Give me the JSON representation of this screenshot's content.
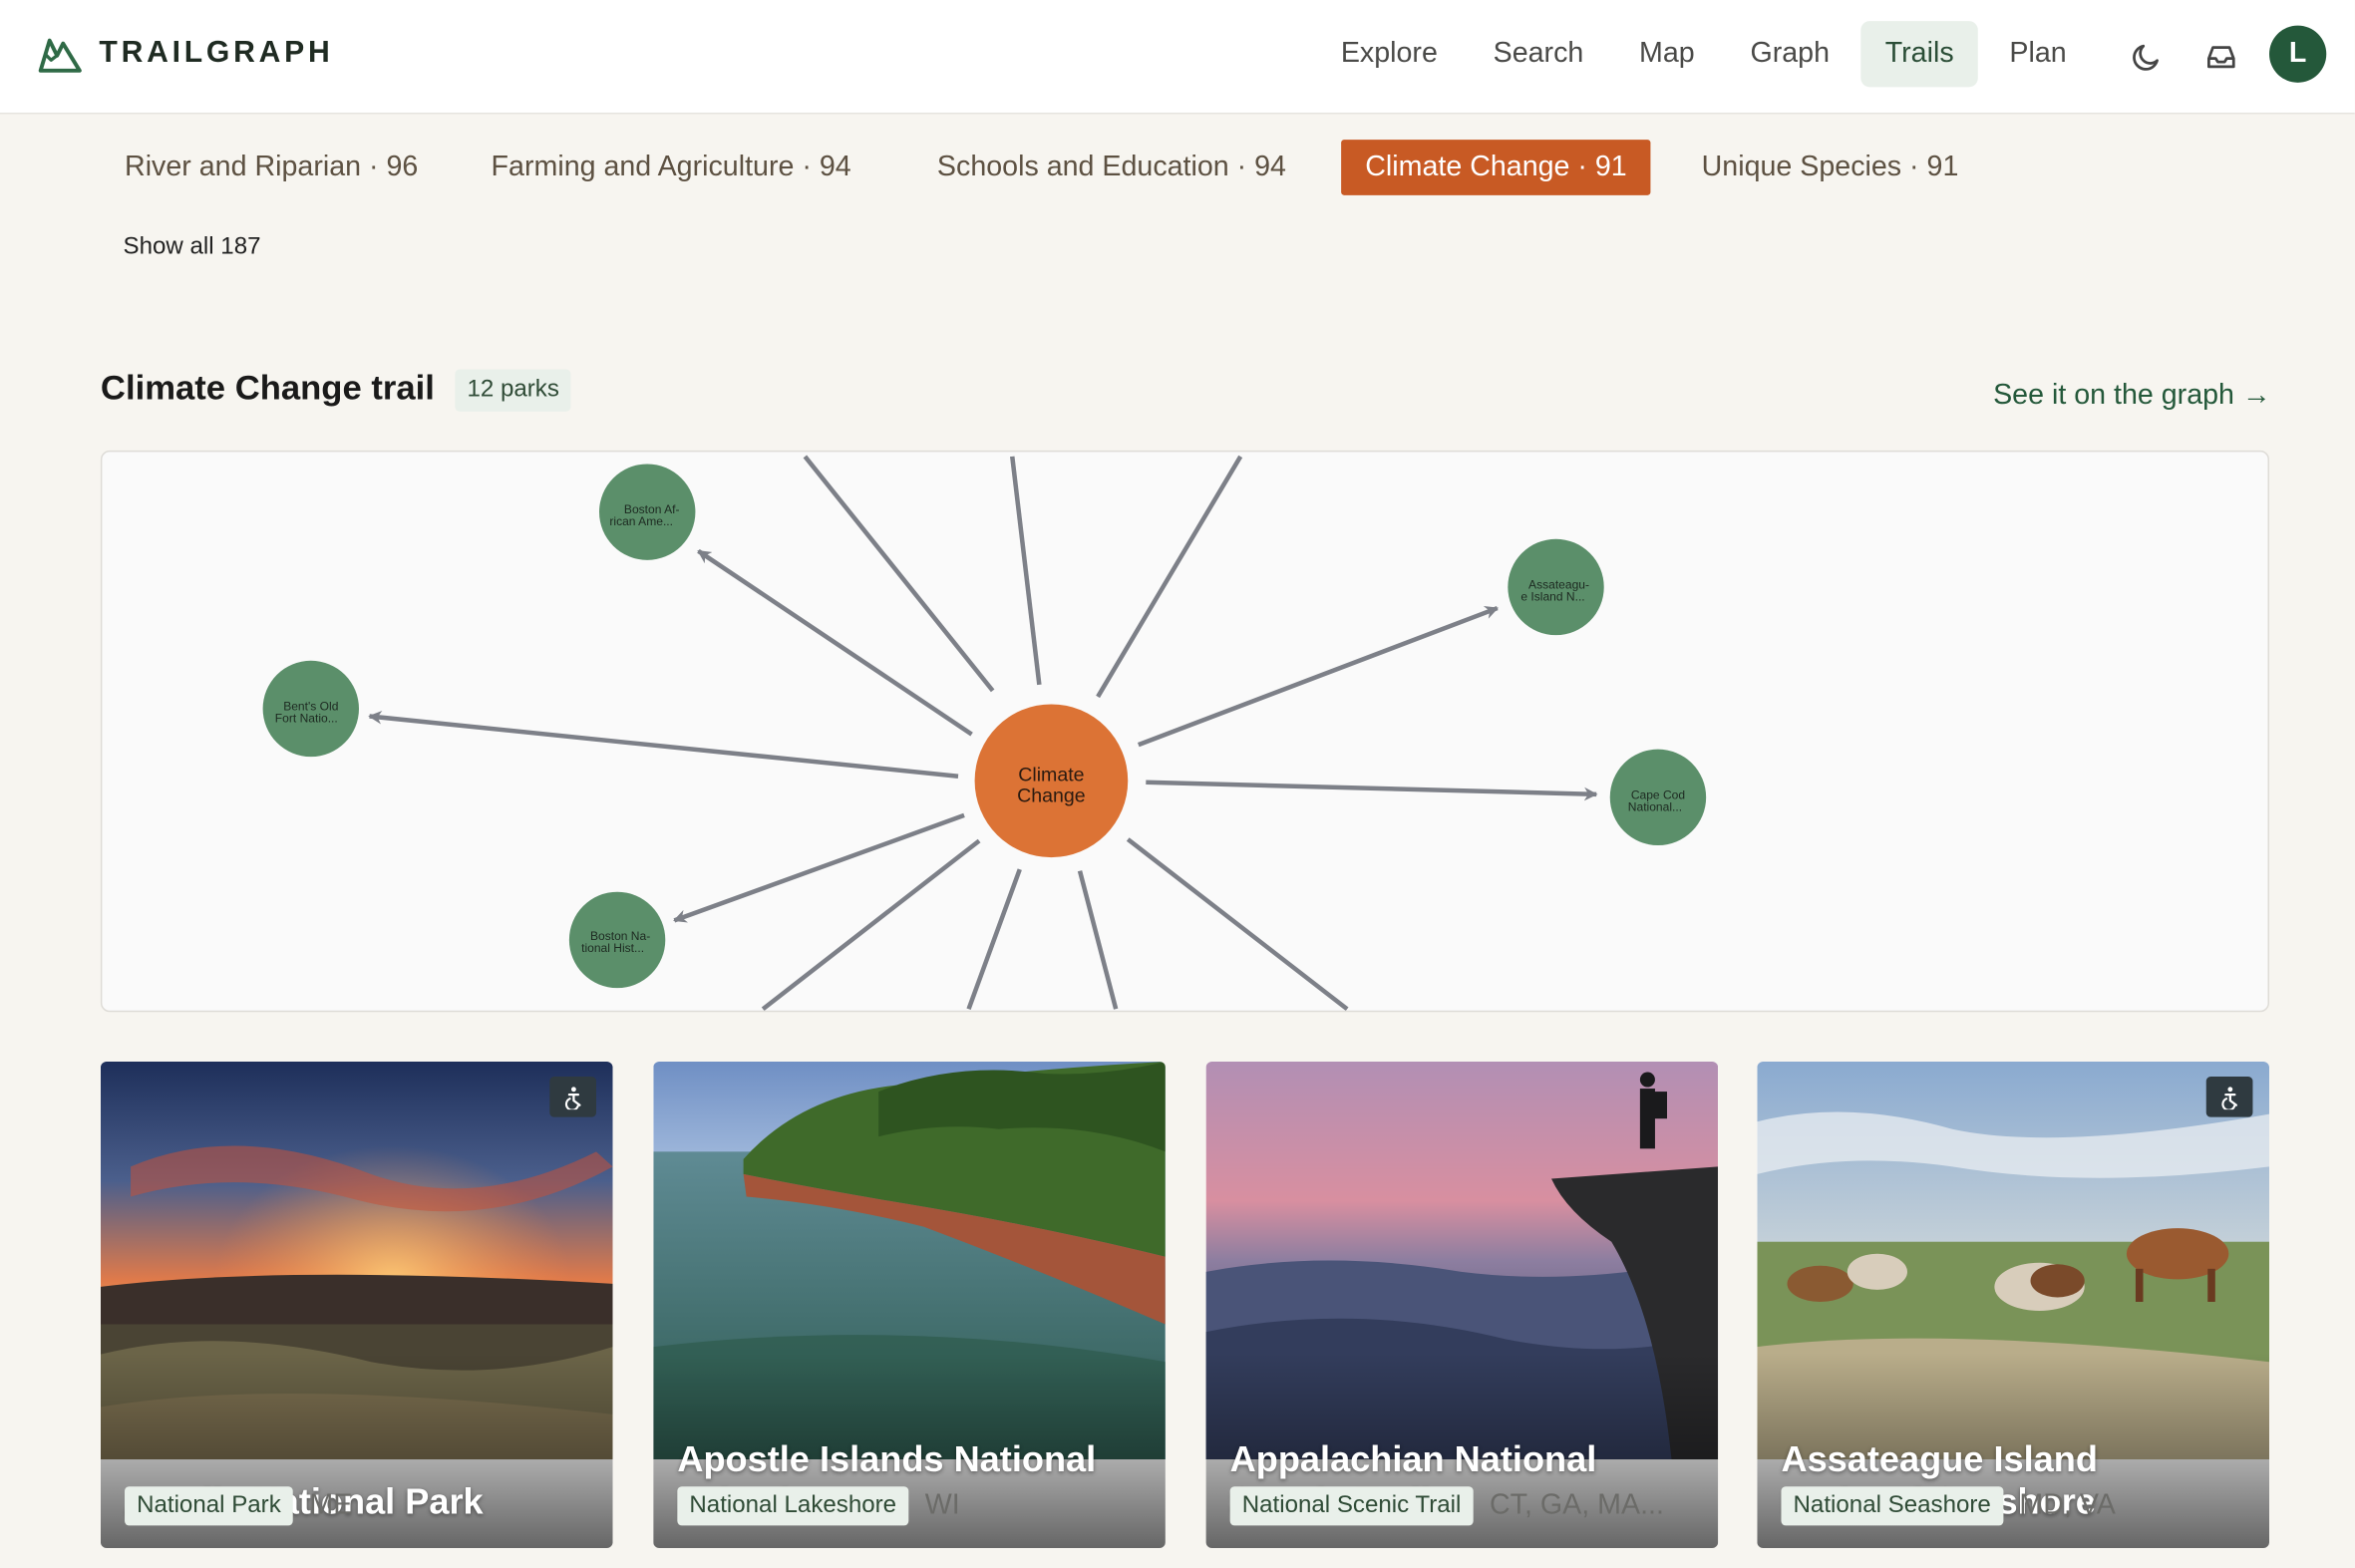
{
  "app": {
    "name": "TRAILGRAPH"
  },
  "nav": {
    "items": [
      {
        "label": "Explore"
      },
      {
        "label": "Search"
      },
      {
        "label": "Map"
      },
      {
        "label": "Graph"
      },
      {
        "label": "Trails",
        "active": true
      },
      {
        "label": "Plan"
      }
    ],
    "icons": [
      "moon-icon",
      "inbox-icon"
    ],
    "avatar_initial": "L"
  },
  "topics": {
    "chips": [
      {
        "label": "River and Riparian · 96"
      },
      {
        "label": "Farming and Agriculture · 94"
      },
      {
        "label": "Schools and Education · 94"
      },
      {
        "label": "Climate Change · 91",
        "active": true
      },
      {
        "label": "Unique Species · 91"
      }
    ],
    "show_all": "Show all 187"
  },
  "trail": {
    "title": "Climate Change trail",
    "count": "12 parks",
    "graph_link": "See it on the graph →"
  },
  "graph": {
    "center": {
      "line1": "Climate",
      "line2": "Change",
      "color": "#dc7335"
    },
    "nodes": [
      {
        "line1": "Boston Af-",
        "line2": "rican Ame..."
      },
      {
        "line1": "Assateagu-",
        "line2": "e Island N..."
      },
      {
        "line1": "Bent's Old",
        "line2": "Fort Natio..."
      },
      {
        "line1": "Cape Cod",
        "line2": "National..."
      },
      {
        "line1": "Boston Na-",
        "line2": "tional Hist..."
      }
    ],
    "node_color": "#5b8f6a",
    "edge_color": "#7d8088"
  },
  "cards": [
    {
      "title": "Acadia National Park",
      "type": "National Park",
      "states": "ME",
      "accessible": true
    },
    {
      "title": "Apostle Islands National Lakeshore",
      "type": "National Lakeshore",
      "states": "WI",
      "accessible": false
    },
    {
      "title": "Appalachian National Scenic Trail",
      "type": "National Scenic Trail",
      "states": "CT, GA, MA...",
      "accessible": false
    },
    {
      "title": "Assateague Island National Seashore",
      "type": "National Seashore",
      "states": "MD, VA",
      "accessible": true
    }
  ]
}
